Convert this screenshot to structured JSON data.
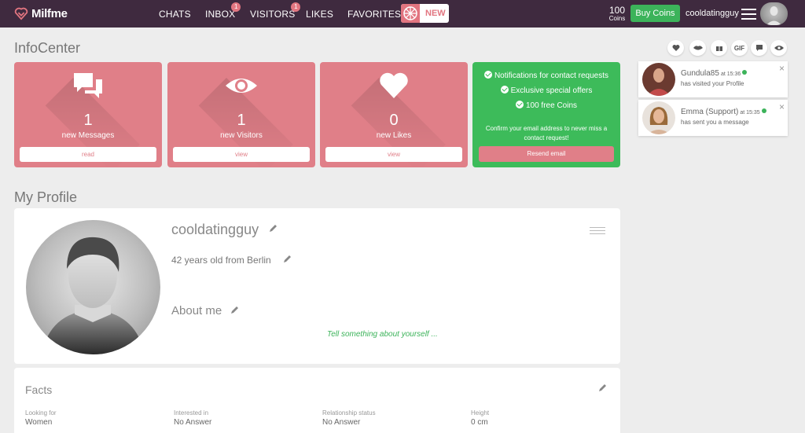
{
  "app": {
    "name": "Milfme"
  },
  "nav": {
    "chats": "CHATS",
    "inbox": "INBOX",
    "inbox_badge": "1",
    "visitors": "VISITORS",
    "visitors_badge": "1",
    "likes": "LIKES",
    "favorites": "FAVORITES",
    "new_label": "NEW"
  },
  "header": {
    "coins_count": "100",
    "coins_label": "Coins",
    "buy_coins": "Buy Coins",
    "username": "cooldatingguy"
  },
  "infocenter": {
    "title": "InfoCenter",
    "cards": [
      {
        "count": "1",
        "label": "new Messages",
        "button": "read",
        "icon": "messages-icon"
      },
      {
        "count": "1",
        "label": "new Visitors",
        "button": "view",
        "icon": "eye-icon"
      },
      {
        "count": "0",
        "label": "new Likes",
        "button": "view",
        "icon": "heart-icon"
      }
    ],
    "promo": {
      "lines": [
        "Notifications for contact requests",
        "Exclusive special offers",
        "100 free Coins"
      ],
      "confirm_text": "Confirm your email address to never miss a contact request!",
      "button": "Resend email"
    }
  },
  "right_icons": [
    "heart-icon",
    "lips-icon",
    "gift-icon",
    "gif-icon",
    "chat-icon",
    "eye-icon"
  ],
  "right_icons_gif_text": "GIF",
  "notifications": [
    {
      "name": "Gundula85",
      "time": "at 15:36",
      "message": "has visited your Profile"
    },
    {
      "name": "Emma (Support)",
      "time": "at 15:35",
      "message": "has sent you a message"
    }
  ],
  "profile": {
    "section_title": "My Profile",
    "username": "cooldatingguy",
    "age_location": "42 years old from Berlin",
    "about_title": "About me",
    "about_placeholder": "Tell something about yourself ..."
  },
  "facts": {
    "title": "Facts",
    "items": [
      {
        "label": "Looking for",
        "value": "Women"
      },
      {
        "label": "Interested in",
        "value": "No Answer"
      },
      {
        "label": "Relationship status",
        "value": "No Answer"
      },
      {
        "label": "Height",
        "value": "0 cm"
      }
    ]
  },
  "colors": {
    "topbar": "#3f2a3f",
    "pink": "#e07f88",
    "green": "#3dbb5a",
    "background": "#ededed"
  }
}
